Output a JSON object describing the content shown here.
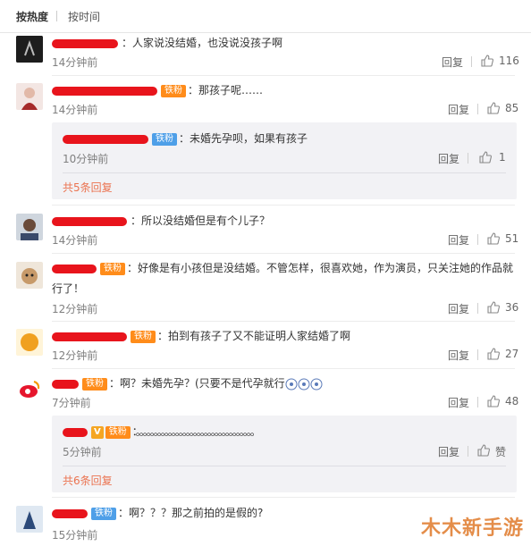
{
  "sort": {
    "hot": "按热度",
    "time": "按时间"
  },
  "comments": [
    {
      "text": "：人家说没结婚，也没说没孩子啊",
      "time": "14分钟前",
      "reply": "回复",
      "likes": "116"
    },
    {
      "badge": "铁粉",
      "text": "：那孩子呢……",
      "time": "14分钟前",
      "reply": "回复",
      "likes": "85",
      "sub": {
        "badge": "铁粉",
        "text": "：未婚先孕呗，如果有孩子",
        "time": "10分钟前",
        "reply": "回复",
        "likes": "1",
        "more": "共5条回复"
      }
    },
    {
      "text": "：所以没结婚但是有个儿子？",
      "time": "14分钟前",
      "reply": "回复",
      "likes": "51"
    },
    {
      "badge": "铁粉",
      "text": "：好像是有小孩但是没结婚。不管怎样，很喜欢她，作为演员，只关注她的作品就行了！",
      "time": "12分钟前",
      "reply": "回复",
      "likes": "36"
    },
    {
      "badge": "铁粉",
      "text": "：拍到有孩子了又不能证明人家结婚了啊",
      "time": "12分钟前",
      "reply": "回复",
      "likes": "27"
    },
    {
      "badge": "铁粉",
      "text": "：啊？未婚先孕？(只要不是代孕就行",
      "time": "7分钟前",
      "reply": "回复",
      "likes": "48",
      "sub": {
        "v": "V",
        "badge": "铁粉",
        "text": "：。。。。。。。。。。。。。。。。。。。。。。。。。。。。。。。。。",
        "time": "5分钟前",
        "reply": "回复",
        "likes": "赞",
        "more": "共6条回复"
      }
    },
    {
      "badge": "铁粉",
      "text": "：啊？？？那之前拍的是假的?",
      "time": "15分钟前"
    }
  ],
  "watermark": "木木新手游",
  "colors": {
    "accent": "#eb7350",
    "redact": "#e8141c",
    "fan_badge": "#ff8c1a"
  }
}
